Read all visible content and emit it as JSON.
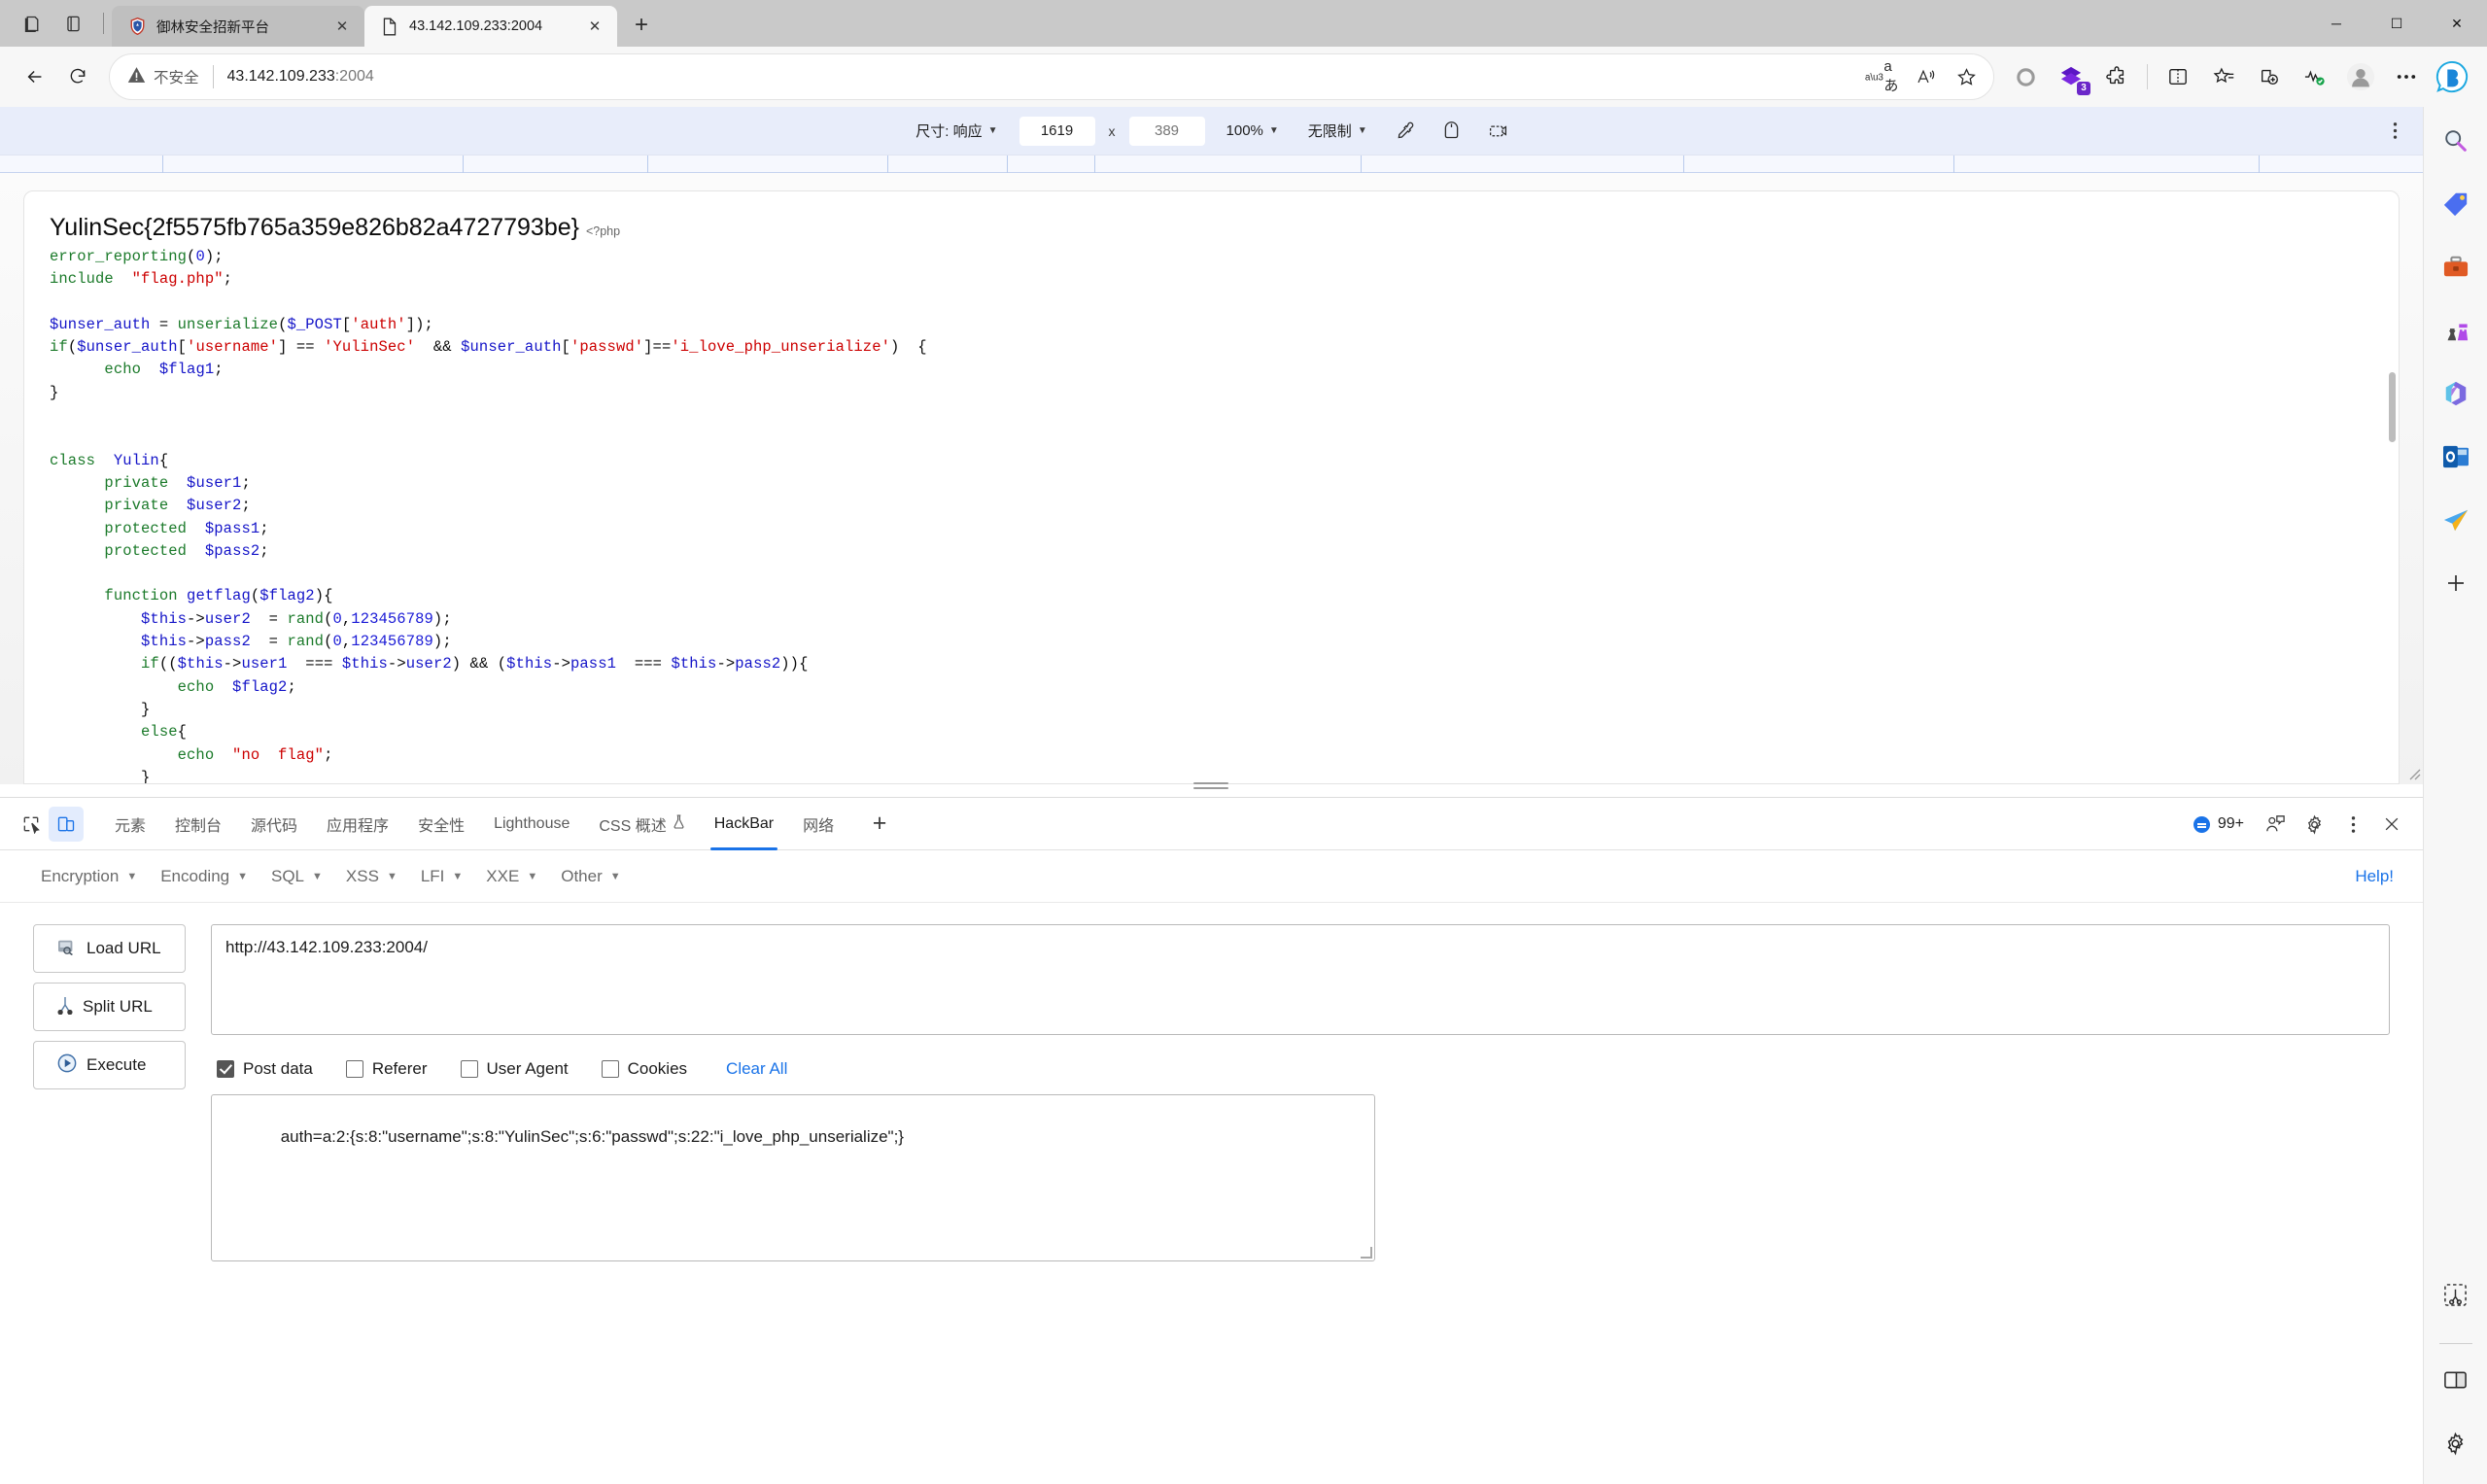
{
  "window": {
    "controls": {
      "minimize": "─",
      "maximize": "☐",
      "close": "✕"
    }
  },
  "tabs": [
    {
      "title": "御林安全招新平台",
      "favicon": "shield-favicon",
      "active": false,
      "close": "✕"
    },
    {
      "title": "43.142.109.233:2004",
      "favicon": "page-favicon",
      "active": true,
      "close": "✕"
    }
  ],
  "new_tab_label": "+",
  "toolbar": {
    "back_icon": "back-arrow-icon",
    "refresh_icon": "refresh-icon",
    "security_label": "不安全",
    "url_host": "43.142.109.233",
    "url_port": ":2004",
    "read_aloud_icon": "read-aloud-icon",
    "translate_icon": "translate-icon",
    "favorite_icon": "star-icon",
    "right_icons": [
      "circle-icon",
      "collections-extension-icon",
      "extensions-puzzle-icon",
      "split-screen-icon",
      "favorites-icon",
      "add-tab-to-collection-icon",
      "browser-essentials-icon",
      "profile-icon",
      "settings-more-icon",
      "copilot-icon"
    ],
    "extension_badge": "3"
  },
  "device_toolbar": {
    "size_label": "尺寸: 响应",
    "width_value": "1619",
    "x_label": "x",
    "height_placeholder": "389",
    "zoom_label": "100%",
    "throttle_label": "无限制",
    "icons": [
      "eyedropper-icon",
      "rotate-icon",
      "screenshot-icon"
    ],
    "more_icon": "kebab-menu-icon"
  },
  "page": {
    "flag_text": "YulinSec{2f5575fb765a359e826b82a4727793be}",
    "php_open_tag": "<?php",
    "code_lines": [
      "error_reporting(0);",
      "include \"flag.php\";",
      "",
      "$unser_auth = unserialize($_POST['auth']);",
      "if($unser_auth['username'] == 'YulinSec' && $unser_auth['passwd']=='i_love_php_unserialize')  {",
      "        echo $flag1;",
      "}",
      "",
      "",
      "class Yulin{",
      "        private $user1;",
      "        private $user2;",
      "        protected $pass1;",
      "        protected $pass2;",
      "",
      "        function getflag($flag2){",
      "                $this->user2 = rand(0,123456789);",
      "                $this->pass2 = rand(0,123456789);",
      "                if(($this->user1 === $this->user2) && ($this->pass1 === $this->pass2)){",
      "                        echo $flag2;",
      "                }",
      "                else{",
      "                        echo \"no flag\";",
      "                }"
    ]
  },
  "devtools": {
    "inspect_icon": "inspect-element-icon",
    "device_icon": "toggle-device-toolbar-icon",
    "tabs": [
      {
        "label": "元素",
        "active": false
      },
      {
        "label": "控制台",
        "active": false
      },
      {
        "label": "源代码",
        "active": false
      },
      {
        "label": "应用程序",
        "active": false
      },
      {
        "label": "安全性",
        "active": false
      },
      {
        "label": "Lighthouse",
        "active": false
      },
      {
        "label": "CSS 概述",
        "active": false,
        "badge_icon": "beaker-icon"
      },
      {
        "label": "HackBar",
        "active": true
      },
      {
        "label": "网络",
        "active": false
      }
    ],
    "more_tabs_label": "+",
    "issues_count": "99+",
    "right_icons": [
      "feedback-icon",
      "settings-gear-icon",
      "kebab-menu-icon",
      "close-icon"
    ]
  },
  "hackbar": {
    "menus": [
      {
        "label": "Encryption"
      },
      {
        "label": "Encoding"
      },
      {
        "label": "SQL"
      },
      {
        "label": "XSS"
      },
      {
        "label": "LFI"
      },
      {
        "label": "XXE"
      },
      {
        "label": "Other"
      }
    ],
    "help_label": "Help!",
    "buttons": [
      {
        "label": "Load URL",
        "icon": "load-url-icon"
      },
      {
        "label": "Split URL",
        "icon": "split-url-scissors-icon"
      },
      {
        "label": "Execute",
        "icon": "execute-play-icon"
      }
    ],
    "url_value": "http://43.142.109.233:2004/",
    "options": [
      {
        "label": "Post data",
        "checked": true
      },
      {
        "label": "Referer",
        "checked": false
      },
      {
        "label": "User Agent",
        "checked": false
      },
      {
        "label": "Cookies",
        "checked": false
      }
    ],
    "clear_all_label": "Clear All",
    "post_data": "auth=a:2:{s:8:\"username\";s:8:\"YulinSec\";s:6:\"passwd\";s:22:\"i_love_php_unserialize\";}"
  },
  "edge_sidebar": {
    "items": [
      "search-icon",
      "shopping-tag-icon",
      "tools-briefcase-icon",
      "games-icon",
      "microsoft365-icon",
      "outlook-icon",
      "send-paper-plane-icon",
      "add-plus-icon"
    ],
    "bottom_items": [
      "screenshot-capture-icon",
      "split-pane-icon",
      "sidebar-settings-icon"
    ]
  },
  "colors": {
    "accent": "#1a73e8",
    "titlebar": "#c9c9c9",
    "device_bar": "#e8edfa",
    "link": "#1a73e8",
    "extension_badge": "#6b27c9",
    "code_string": "#cc0000",
    "code_keyword": "#1a1ad6",
    "code_function": "#1b7a2a"
  }
}
